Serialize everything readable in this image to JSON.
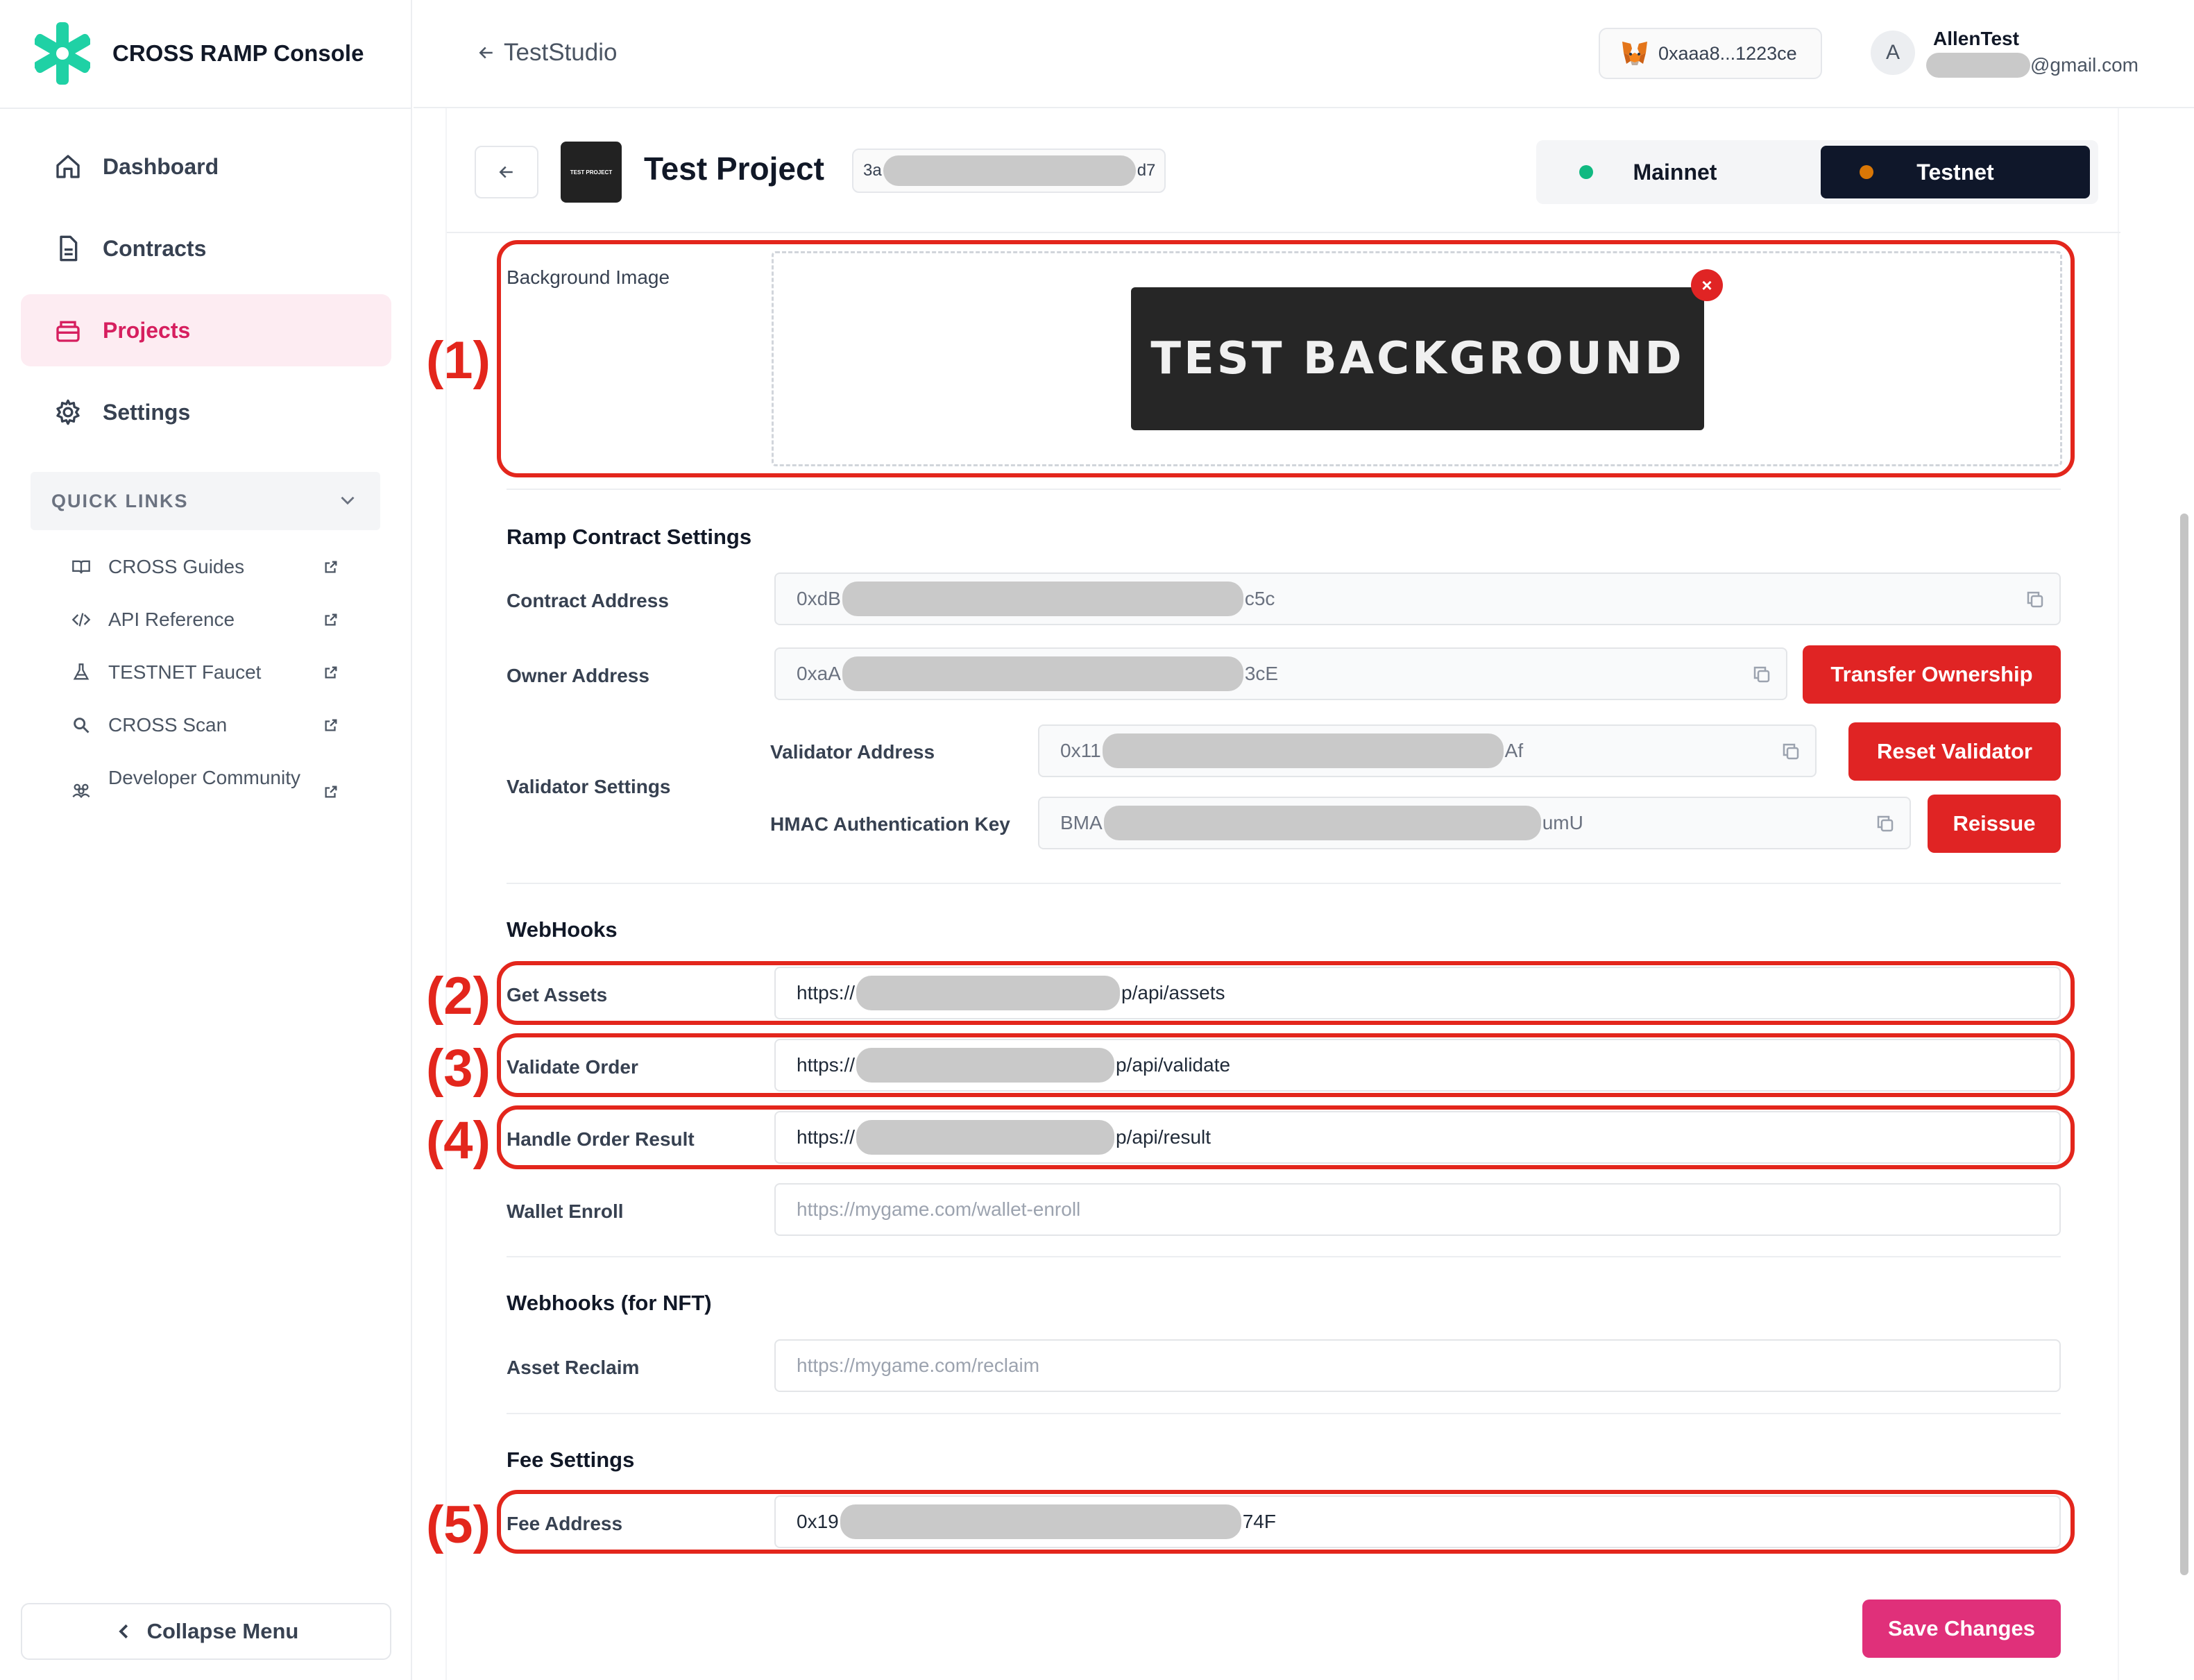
{
  "brand": {
    "name": "CROSS RAMP Console",
    "logo_icon": "cross-asterisk-logo",
    "accent": "#1fd1a5"
  },
  "sidebar": {
    "items": [
      {
        "label": "Dashboard",
        "icon": "home-icon"
      },
      {
        "label": "Contracts",
        "icon": "document-icon"
      },
      {
        "label": "Projects",
        "icon": "box-icon",
        "active": true
      },
      {
        "label": "Settings",
        "icon": "gear-icon"
      }
    ],
    "quick_links": {
      "title": "QUICK LINKS",
      "items": [
        {
          "label": "CROSS Guides",
          "icon": "book-icon"
        },
        {
          "label": "API Reference",
          "icon": "code-icon"
        },
        {
          "label": "TESTNET Faucet",
          "icon": "flask-icon"
        },
        {
          "label": "CROSS Scan",
          "icon": "search-icon"
        },
        {
          "label": "Developer Community",
          "icon": "community-icon"
        }
      ]
    },
    "collapse_label": "Collapse Menu"
  },
  "header": {
    "breadcrumb": "TestStudio",
    "wallet": "0xaaa8...1223ce",
    "user": {
      "avatar_letter": "A",
      "name": "AllenTest",
      "email_suffix": "@gmail.com"
    }
  },
  "project": {
    "thumb_text": "TEST PROJECT",
    "title": "Test Project",
    "id_prefix": "3a",
    "id_suffix": "d7",
    "networks": {
      "mainnet": "Mainnet",
      "testnet": "Testnet",
      "selected": "Testnet",
      "mainnet_color": "#10b981",
      "testnet_color": "#d97706"
    }
  },
  "form": {
    "background": {
      "label": "Background Image",
      "image_text": "TEST BACKGROUND",
      "remove_symbol": "×"
    },
    "ramp": {
      "title": "Ramp Contract Settings",
      "contract_address": {
        "label": "Contract Address",
        "prefix": "0xdB",
        "suffix": "c5c"
      },
      "owner_address": {
        "label": "Owner Address",
        "prefix": "0xaA",
        "suffix": "3cE",
        "button": "Transfer Ownership"
      },
      "validator": {
        "label": "Validator Settings",
        "address": {
          "label": "Validator Address",
          "prefix": "0x11",
          "suffix": "Af",
          "button": "Reset Validator"
        },
        "hmac": {
          "label": "HMAC Authentication Key",
          "prefix": "BMA",
          "suffix": "umU",
          "button": "Reissue"
        }
      }
    },
    "webhooks": {
      "title": "WebHooks",
      "get_assets": {
        "label": "Get Assets",
        "prefix": "https://",
        "suffix": "p/api/assets"
      },
      "validate_order": {
        "label": "Validate Order",
        "prefix": "https://",
        "suffix": "p/api/validate"
      },
      "handle_result": {
        "label": "Handle Order Result",
        "prefix": "https://",
        "suffix": "p/api/result"
      },
      "wallet_enroll": {
        "label": "Wallet Enroll",
        "placeholder": "https://mygame.com/wallet-enroll"
      }
    },
    "nft": {
      "title": "Webhooks (for NFT)",
      "asset_reclaim": {
        "label": "Asset Reclaim",
        "placeholder": "https://mygame.com/reclaim"
      }
    },
    "fee": {
      "title": "Fee Settings",
      "fee_address": {
        "label": "Fee Address",
        "prefix": "0x19",
        "suffix": "74F"
      }
    },
    "save_label": "Save Changes"
  },
  "annotations": [
    "(1)",
    "(2)",
    "(3)",
    "(4)",
    "(5)"
  ]
}
